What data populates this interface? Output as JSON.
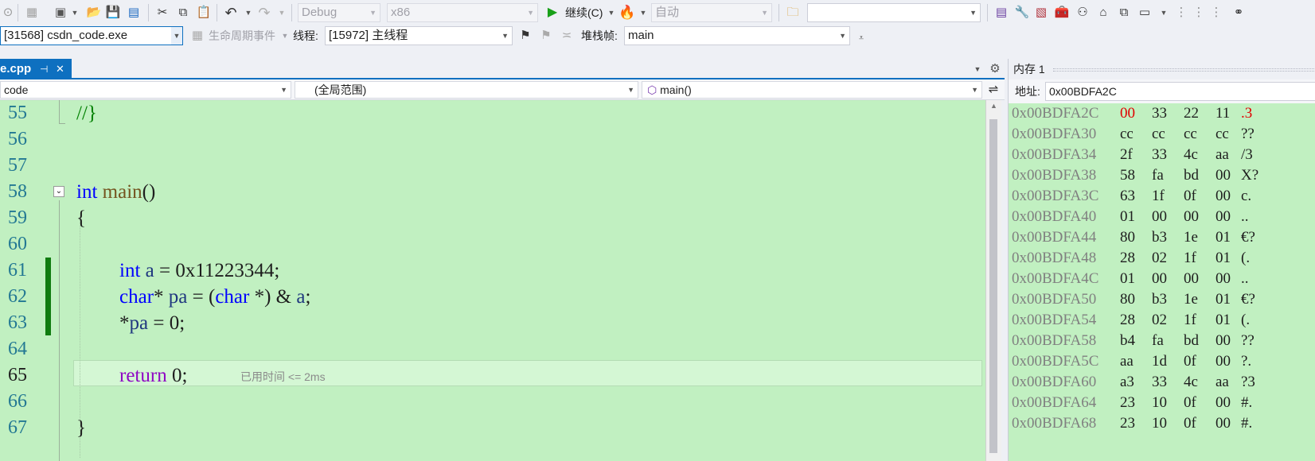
{
  "toolbar": {
    "config": "Debug",
    "platform": "x86",
    "continue_label": "继续(C)",
    "auto_label": "自动",
    "search_value": ""
  },
  "debugbar": {
    "process": "[31568] csdn_code.exe",
    "lifecycle_label": "生命周期事件",
    "thread_label": "线程:",
    "thread_value": "[15972] 主线程",
    "stackframe_label": "堆栈帧:",
    "stackframe_value": "main"
  },
  "editor_tab": {
    "label": "e.cpp",
    "pin_glyph": "⊣",
    "close_glyph": "✕"
  },
  "navbar": {
    "project": "code",
    "scope": "(全局范围)",
    "member": "main()"
  },
  "code_lines": [
    {
      "num": "55",
      "text": "//}"
    },
    {
      "num": "56",
      "text": ""
    },
    {
      "num": "57",
      "text": ""
    },
    {
      "num": "58",
      "text": "int main()"
    },
    {
      "num": "59",
      "text": "{"
    },
    {
      "num": "60",
      "text": ""
    },
    {
      "num": "61",
      "text": "int a = 0x11223344;"
    },
    {
      "num": "62",
      "text": "char* pa = (char *) & a;"
    },
    {
      "num": "63",
      "text": "*pa = 0;"
    },
    {
      "num": "64",
      "text": ""
    },
    {
      "num": "65",
      "text": "return 0;"
    },
    {
      "num": "66",
      "text": ""
    },
    {
      "num": "67",
      "text": "}"
    }
  ],
  "elapsed_hint": "已用时间 <= 2ms",
  "memory": {
    "title": "内存 1",
    "addr_label": "地址:",
    "addr_value": "0x00BDFA2C",
    "rows": [
      {
        "addr": "0x00BDFA2C",
        "bytes": [
          "00",
          "33",
          "22",
          "11"
        ],
        "ascii": ".3"
      },
      {
        "addr": "0x00BDFA30",
        "bytes": [
          "cc",
          "cc",
          "cc",
          "cc"
        ],
        "ascii": "??"
      },
      {
        "addr": "0x00BDFA34",
        "bytes": [
          "2f",
          "33",
          "4c",
          "aa"
        ],
        "ascii": "/3"
      },
      {
        "addr": "0x00BDFA38",
        "bytes": [
          "58",
          "fa",
          "bd",
          "00"
        ],
        "ascii": "X?"
      },
      {
        "addr": "0x00BDFA3C",
        "bytes": [
          "63",
          "1f",
          "0f",
          "00"
        ],
        "ascii": "c."
      },
      {
        "addr": "0x00BDFA40",
        "bytes": [
          "01",
          "00",
          "00",
          "00"
        ],
        "ascii": ".."
      },
      {
        "addr": "0x00BDFA44",
        "bytes": [
          "80",
          "b3",
          "1e",
          "01"
        ],
        "ascii": "€?"
      },
      {
        "addr": "0x00BDFA48",
        "bytes": [
          "28",
          "02",
          "1f",
          "01"
        ],
        "ascii": "(."
      },
      {
        "addr": "0x00BDFA4C",
        "bytes": [
          "01",
          "00",
          "00",
          "00"
        ],
        "ascii": ".."
      },
      {
        "addr": "0x00BDFA50",
        "bytes": [
          "80",
          "b3",
          "1e",
          "01"
        ],
        "ascii": "€?"
      },
      {
        "addr": "0x00BDFA54",
        "bytes": [
          "28",
          "02",
          "1f",
          "01"
        ],
        "ascii": "(."
      },
      {
        "addr": "0x00BDFA58",
        "bytes": [
          "b4",
          "fa",
          "bd",
          "00"
        ],
        "ascii": "??"
      },
      {
        "addr": "0x00BDFA5C",
        "bytes": [
          "aa",
          "1d",
          "0f",
          "00"
        ],
        "ascii": "?."
      },
      {
        "addr": "0x00BDFA60",
        "bytes": [
          "a3",
          "33",
          "4c",
          "aa"
        ],
        "ascii": "?3"
      },
      {
        "addr": "0x00BDFA64",
        "bytes": [
          "23",
          "10",
          "0f",
          "00"
        ],
        "ascii": "#."
      },
      {
        "addr": "0x00BDFA68",
        "bytes": [
          "23",
          "10",
          "0f",
          "00"
        ],
        "ascii": "#."
      }
    ]
  },
  "colors": {
    "editor_bg": "#c1f0c1",
    "changed_byte": "#e00000",
    "active_tab": "#0e70c0",
    "change_bar": "#107c10"
  }
}
